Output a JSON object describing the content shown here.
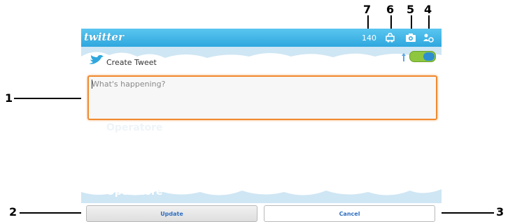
{
  "app": {
    "logo_text": "twitter",
    "char_count": "140",
    "create_label": "Create Tweet",
    "accent": "#2fa7de",
    "focus_color": "#f08a30"
  },
  "compose": {
    "placeholder": "What's happening?",
    "watermark_top": "Operatore",
    "watermark_bottom": "Operatore"
  },
  "buttons": {
    "update_label": "Update",
    "cancel_label": "Cancel"
  },
  "callouts": {
    "c1": "1",
    "c2": "2",
    "c3": "3",
    "c4": "4",
    "c5": "5",
    "c6": "6",
    "c7": "7"
  },
  "icons": {
    "title_icons": [
      "location-icon",
      "camera-icon",
      "account-icon"
    ],
    "create_icon": "bird-icon",
    "toggle_icon": "gps-toggle"
  }
}
